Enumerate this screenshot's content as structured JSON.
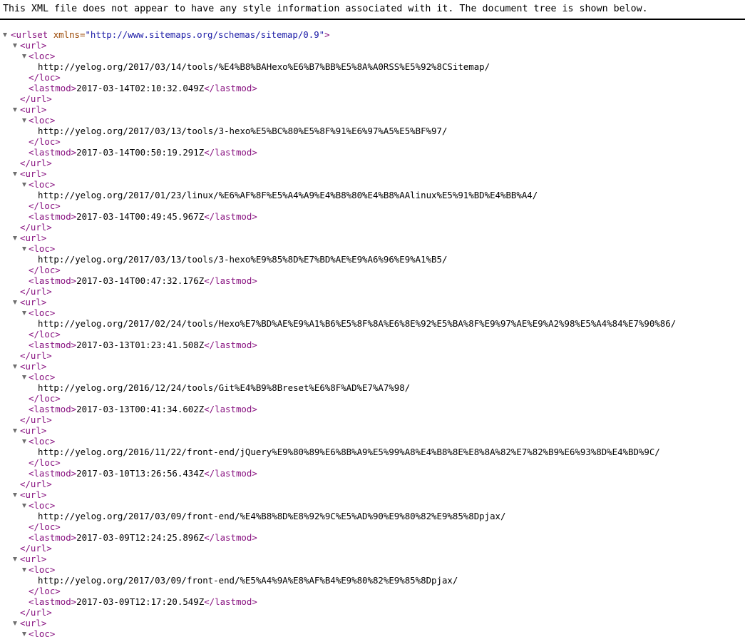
{
  "header": {
    "notice": "This XML file does not appear to have any style information associated with it. The document tree is shown below."
  },
  "root": {
    "open_tag": "<urlset",
    "attr_name": "xmlns=",
    "attr_value": "\"http://www.sitemaps.org/schemas/sitemap/0.9\"",
    "open_tag_end": ">"
  },
  "tags": {
    "url_open": "<url>",
    "url_close": "</url>",
    "loc_open": "<loc>",
    "loc_close": "</loc>",
    "lastmod_open": "<lastmod>",
    "lastmod_close": "</lastmod>"
  },
  "entries": [
    {
      "loc": "http://yelog.org/2017/03/14/tools/%E4%B8%BAHexo%E6%B7%BB%E5%8A%A0RSS%E5%92%8CSitemap/",
      "lastmod": "2017-03-14T02:10:32.049Z"
    },
    {
      "loc": "http://yelog.org/2017/03/13/tools/3-hexo%E5%BC%80%E5%8F%91%E6%97%A5%E5%BF%97/",
      "lastmod": "2017-03-14T00:50:19.291Z"
    },
    {
      "loc": "http://yelog.org/2017/01/23/linux/%E6%AF%8F%E5%A4%A9%E4%B8%80%E4%B8%AAlinux%E5%91%BD%E4%BB%A4/",
      "lastmod": "2017-03-14T00:49:45.967Z"
    },
    {
      "loc": "http://yelog.org/2017/03/13/tools/3-hexo%E9%85%8D%E7%BD%AE%E9%A6%96%E9%A1%B5/",
      "lastmod": "2017-03-14T00:47:32.176Z"
    },
    {
      "loc": "http://yelog.org/2017/02/24/tools/Hexo%E7%BD%AE%E9%A1%B6%E5%8F%8A%E6%8E%92%E5%BA%8F%E9%97%AE%E9%A2%98%E5%A4%84%E7%90%86/",
      "lastmod": "2017-03-13T01:23:41.508Z"
    },
    {
      "loc": "http://yelog.org/2016/12/24/tools/Git%E4%B9%8Breset%E6%8F%AD%E7%A7%98/",
      "lastmod": "2017-03-13T00:41:34.602Z"
    },
    {
      "loc": "http://yelog.org/2016/11/22/front-end/jQuery%E9%80%89%E6%8B%A9%E5%99%A8%E4%B8%8E%E8%8A%82%E7%82%B9%E6%93%8D%E4%BD%9C/",
      "lastmod": "2017-03-10T13:26:56.434Z"
    },
    {
      "loc": "http://yelog.org/2017/03/09/front-end/%E4%B8%8D%E8%92%9C%E5%AD%90%E9%80%82%E9%85%8Dpjax/",
      "lastmod": "2017-03-09T12:24:25.896Z"
    },
    {
      "loc": "http://yelog.org/2017/03/09/front-end/%E5%A4%9A%E8%AF%B4%E9%80%82%E9%85%8Dpjax/",
      "lastmod": "2017-03-09T12:17:20.549Z"
    }
  ]
}
